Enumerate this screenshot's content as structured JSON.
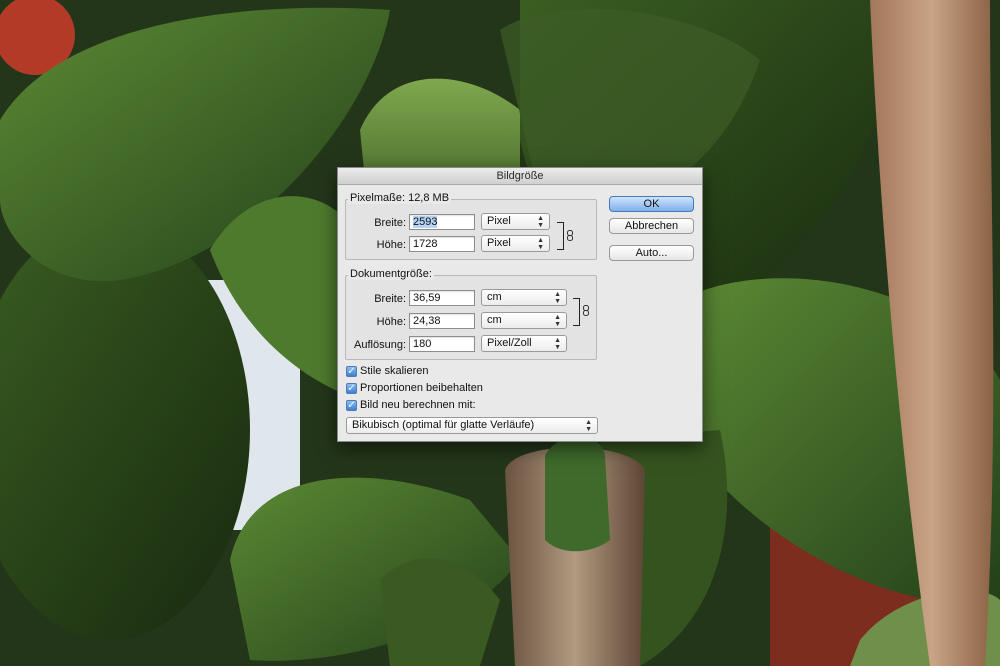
{
  "dialog": {
    "title": "Bildgröße",
    "ok_label": "OK",
    "cancel_label": "Abbrechen",
    "auto_label": "Auto...",
    "pixel_dimensions": {
      "title": "Pixelmaße: 12,8 MB",
      "width_label": "Breite:",
      "width_value": "2593",
      "width_unit": "Pixel",
      "height_label": "Höhe:",
      "height_value": "1728",
      "height_unit": "Pixel"
    },
    "document_size": {
      "title": "Dokumentgröße:",
      "width_label": "Breite:",
      "width_value": "36,59",
      "width_unit": "cm",
      "height_label": "Höhe:",
      "height_value": "24,38",
      "height_unit": "cm",
      "resolution_label": "Auflösung:",
      "resolution_value": "180",
      "resolution_unit": "Pixel/Zoll"
    },
    "options": {
      "scale_styles": {
        "label": "Stile skalieren",
        "checked": true
      },
      "constrain_proportions": {
        "label": "Proportionen beibehalten",
        "checked": true
      },
      "resample": {
        "label": "Bild neu berechnen mit:",
        "checked": true
      }
    },
    "resample_method": "Bikubisch (optimal für glatte Verläufe)"
  },
  "icons": {
    "link": "chain-link-icon",
    "checkmark": "checkmark-icon",
    "dropdown": "up-down-arrows-icon"
  },
  "colors": {
    "default_button": "#7fb0ec",
    "selection": "#b4d3f5",
    "leaf_dark": "#2f4a1e",
    "leaf_light": "#5f8a3a",
    "bark": "#9c8064"
  }
}
